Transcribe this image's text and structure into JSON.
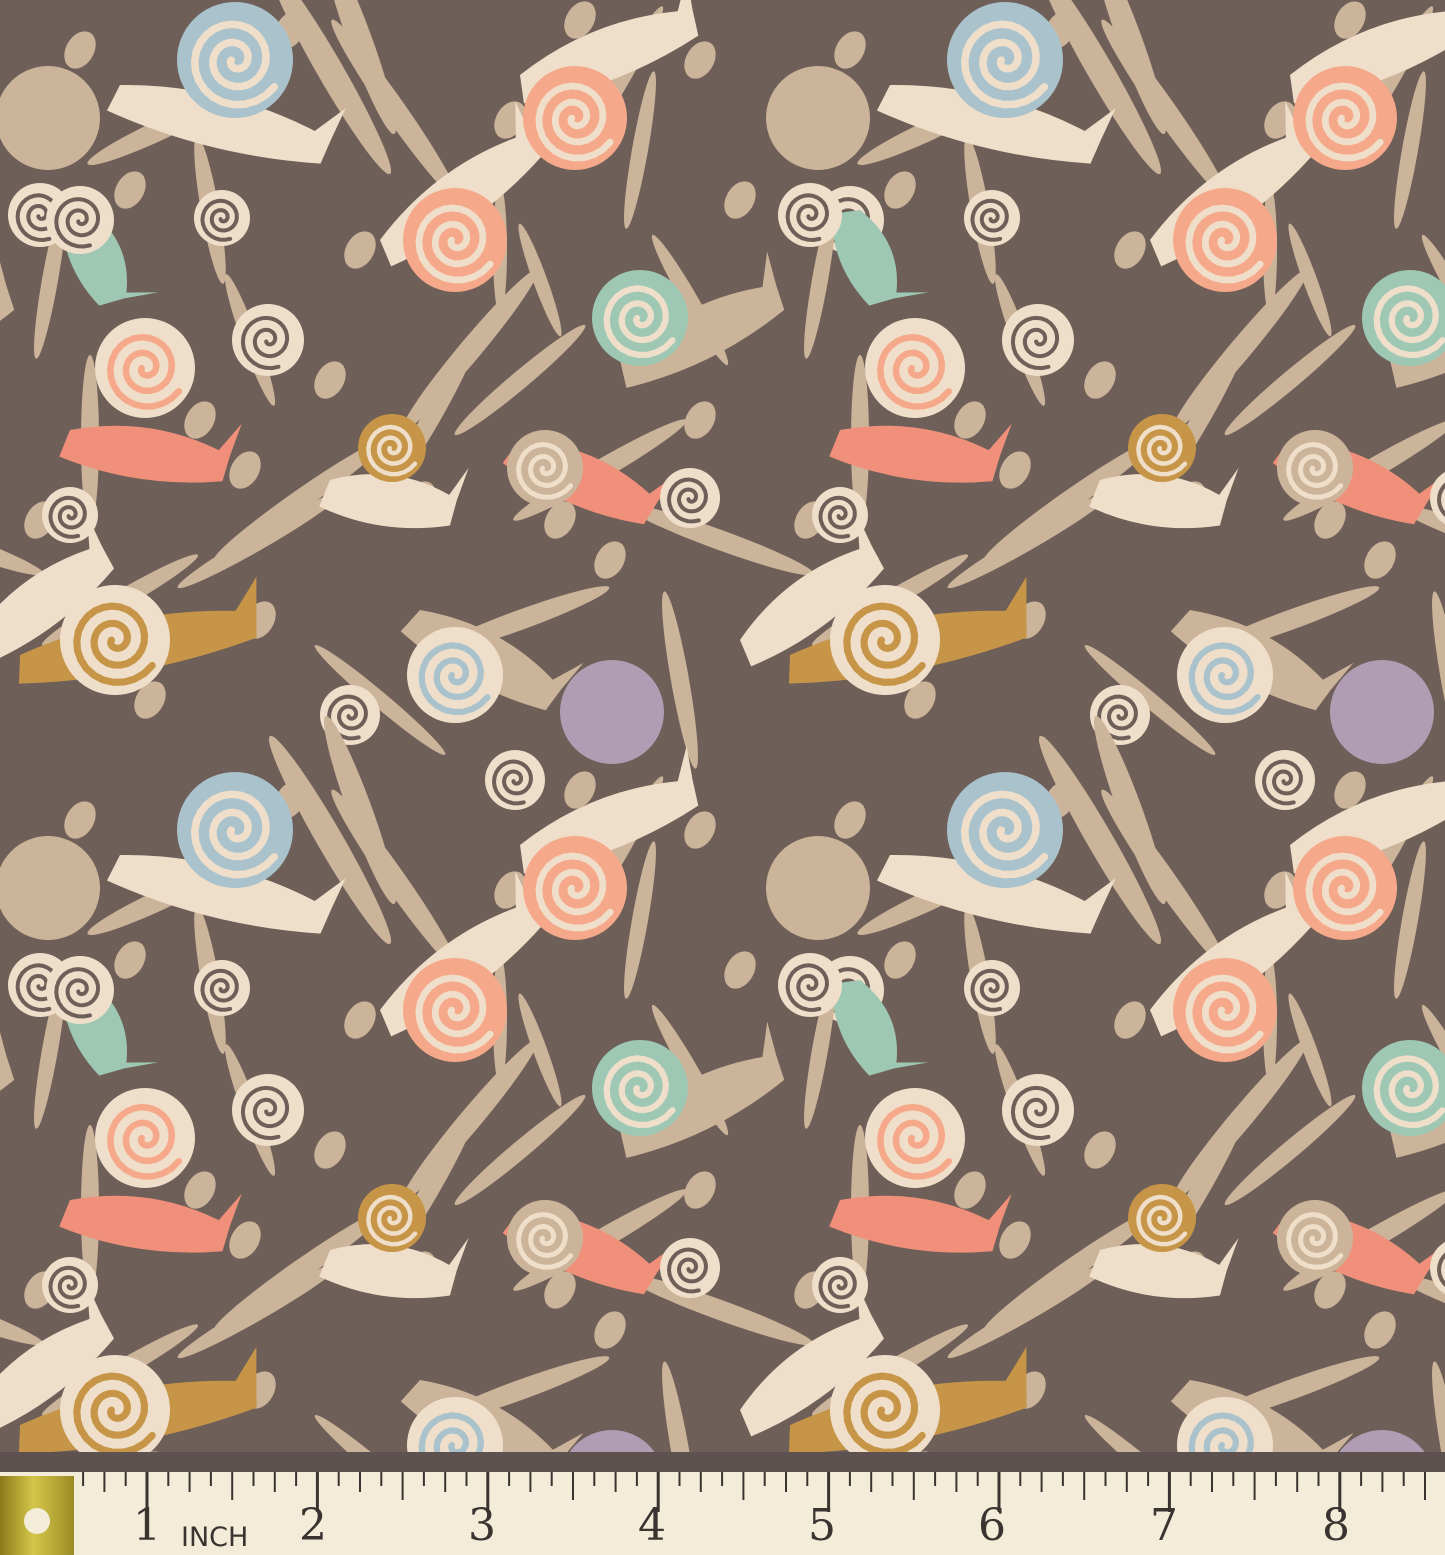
{
  "pattern": {
    "motif": "snails",
    "colors": {
      "background": "#6e5f59",
      "tan": "#cbb49a",
      "cream": "#efdfca",
      "blue": "#a9c2cc",
      "peach": "#f6a98a",
      "coral": "#f0907a",
      "mint": "#9ec8b4",
      "lavender": "#b09cb3",
      "mustard": "#c79547"
    }
  },
  "ruler": {
    "unit_label": "INCH",
    "numbers": [
      "1",
      "2",
      "3",
      "4",
      "5",
      "6",
      "7",
      "8"
    ]
  }
}
